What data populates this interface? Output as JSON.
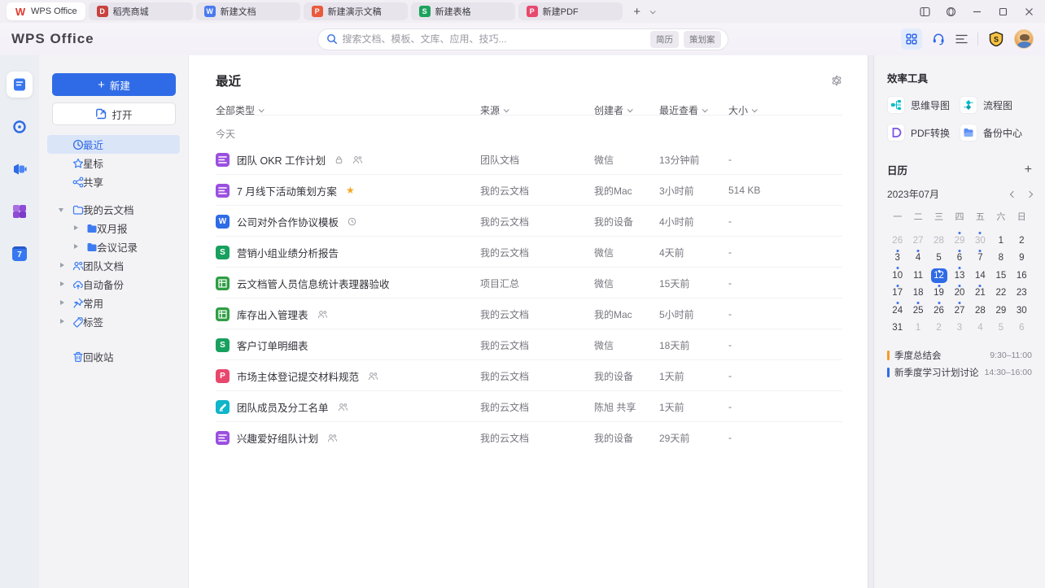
{
  "tabbar": {
    "tabs": [
      {
        "label": "WPS Office",
        "icon": "wps-logo",
        "glyph": "W",
        "color": "#e0392b",
        "active": true
      },
      {
        "label": "稻壳商城",
        "icon": "docer",
        "glyph": "D",
        "color": "#c8423e"
      },
      {
        "label": "新建文档",
        "icon": "writer",
        "glyph": "W",
        "color": "#4a7af0"
      },
      {
        "label": "新建演示文稿",
        "icon": "presentation",
        "glyph": "P",
        "color": "#ea5a3b"
      },
      {
        "label": "新建表格",
        "icon": "spreadsheet",
        "glyph": "S",
        "color": "#1ea25d"
      },
      {
        "label": "新建PDF",
        "icon": "pdf",
        "glyph": "P",
        "color": "#e8486d"
      }
    ],
    "add_tab": "+"
  },
  "header": {
    "logo": "WPS Office",
    "search_placeholder": "搜索文档、模板、文库、应用、技巧...",
    "search_tags": [
      "简历",
      "策划案"
    ]
  },
  "rail": {
    "calendar_day": "7"
  },
  "sidebar": {
    "new_label": "新建",
    "open_label": "打开",
    "nav": [
      {
        "label": "最近",
        "icon": "clock",
        "active": true
      },
      {
        "label": "星标",
        "icon": "star"
      },
      {
        "label": "共享",
        "icon": "share"
      }
    ],
    "tree": [
      {
        "label": "我的云文档",
        "icon": "folder-outline",
        "expanded": true
      },
      {
        "label": "双月报",
        "icon": "folder-blue"
      },
      {
        "label": "会议记录",
        "icon": "folder-blue"
      },
      {
        "label": "团队文档",
        "icon": "team"
      },
      {
        "label": "自动备份",
        "icon": "cloud-backup"
      },
      {
        "label": "常用",
        "icon": "pin"
      },
      {
        "label": "标签",
        "icon": "tag"
      }
    ],
    "trash_label": "回收站"
  },
  "main": {
    "title": "最近",
    "filters": [
      "全部类型",
      "来源",
      "创建者",
      "最近查看",
      "大小"
    ],
    "group_label": "今天",
    "rows": [
      {
        "icon": "docs",
        "name": "团队 OKR 工作计划",
        "badges": [
          "lock",
          "members"
        ],
        "source": "团队文档",
        "creator": "微信",
        "viewed": "13分钟前",
        "size": "-"
      },
      {
        "icon": "docs",
        "name": "7 月线下活动策划方案",
        "badges": [
          "star"
        ],
        "source": "我的云文档",
        "creator": "我的Mac",
        "viewed": "3小时前",
        "size": "514 KB"
      },
      {
        "icon": "word",
        "name": "公司对外合作协议模板",
        "badges": [
          "history"
        ],
        "source": "我的云文档",
        "creator": "我的设备",
        "viewed": "4小时前",
        "size": "-"
      },
      {
        "icon": "sheet",
        "name": "营销小组业绩分析报告",
        "badges": [],
        "source": "我的云文档",
        "creator": "微信",
        "viewed": "4天前",
        "size": "-"
      },
      {
        "icon": "grid",
        "name": "云文档管人员信息统计表理器验收",
        "badges": [],
        "source": "项目汇总",
        "creator": "微信",
        "viewed": "15天前",
        "size": "-"
      },
      {
        "icon": "grid",
        "name": "库存出入管理表",
        "badges": [
          "members"
        ],
        "source": "我的云文档",
        "creator": "我的Mac",
        "viewed": "5小时前",
        "size": "-"
      },
      {
        "icon": "sheet",
        "name": "客户订单明细表",
        "badges": [],
        "source": "我的云文档",
        "creator": "微信",
        "viewed": "18天前",
        "size": "-"
      },
      {
        "icon": "pdf",
        "name": "市场主体登记提交材料规范",
        "badges": [
          "members"
        ],
        "source": "我的云文档",
        "creator": "我的设备",
        "viewed": "1天前",
        "size": "-"
      },
      {
        "icon": "form",
        "name": "团队成员及分工名单",
        "badges": [
          "members"
        ],
        "source": "我的云文档",
        "creator": "陈旭 共享",
        "viewed": "1天前",
        "size": "-"
      },
      {
        "icon": "docs",
        "name": "兴趣爱好组队计划",
        "badges": [
          "members"
        ],
        "source": "我的云文档",
        "creator": "我的设备",
        "viewed": "29天前",
        "size": "-"
      }
    ]
  },
  "tools": {
    "title": "效率工具",
    "items": [
      {
        "label": "思维导图",
        "icon": "mindmap"
      },
      {
        "label": "流程图",
        "icon": "flowchart"
      },
      {
        "label": "PDF转换",
        "icon": "pdf-convert"
      },
      {
        "label": "备份中心",
        "icon": "backup"
      }
    ]
  },
  "calendar": {
    "title": "日历",
    "add": "+",
    "month": "2023年07月",
    "weekdays": [
      "一",
      "二",
      "三",
      "四",
      "五",
      "六",
      "日"
    ],
    "days": [
      {
        "d": 26,
        "out": true
      },
      {
        "d": 27,
        "out": true
      },
      {
        "d": 28,
        "out": true
      },
      {
        "d": 29,
        "out": true,
        "dot": true
      },
      {
        "d": 30,
        "out": true,
        "dot": true
      },
      {
        "d": 1
      },
      {
        "d": 2
      },
      {
        "d": 3,
        "dot": true
      },
      {
        "d": 4,
        "dot": true
      },
      {
        "d": 5
      },
      {
        "d": 6,
        "dot": true
      },
      {
        "d": 7,
        "dot": true
      },
      {
        "d": 8
      },
      {
        "d": 9
      },
      {
        "d": 10,
        "dot": true
      },
      {
        "d": 11
      },
      {
        "d": 12,
        "sel": true,
        "dot": true
      },
      {
        "d": 13,
        "dot": true
      },
      {
        "d": 14
      },
      {
        "d": 15
      },
      {
        "d": 16
      },
      {
        "d": 17,
        "dot": true
      },
      {
        "d": 18
      },
      {
        "d": 19,
        "dot": true
      },
      {
        "d": 20,
        "dot": true
      },
      {
        "d": 21,
        "dot": true
      },
      {
        "d": 22
      },
      {
        "d": 23
      },
      {
        "d": 24,
        "dot": true
      },
      {
        "d": 25,
        "dot": true
      },
      {
        "d": 26,
        "dot": true
      },
      {
        "d": 27,
        "dot": true
      },
      {
        "d": 28
      },
      {
        "d": 29
      },
      {
        "d": 30
      },
      {
        "d": 31
      },
      {
        "d": 1,
        "out": true
      },
      {
        "d": 2,
        "out": true
      },
      {
        "d": 3,
        "out": true
      },
      {
        "d": 4,
        "out": true
      },
      {
        "d": 5,
        "out": true
      },
      {
        "d": 6,
        "out": true
      }
    ],
    "events": [
      {
        "title": "季度总结会",
        "time": "9:30–11:00",
        "color": "#f59b27"
      },
      {
        "title": "新季度学习计划讨论",
        "time": "14:30–16:00",
        "color": "#2f6be6"
      }
    ]
  }
}
